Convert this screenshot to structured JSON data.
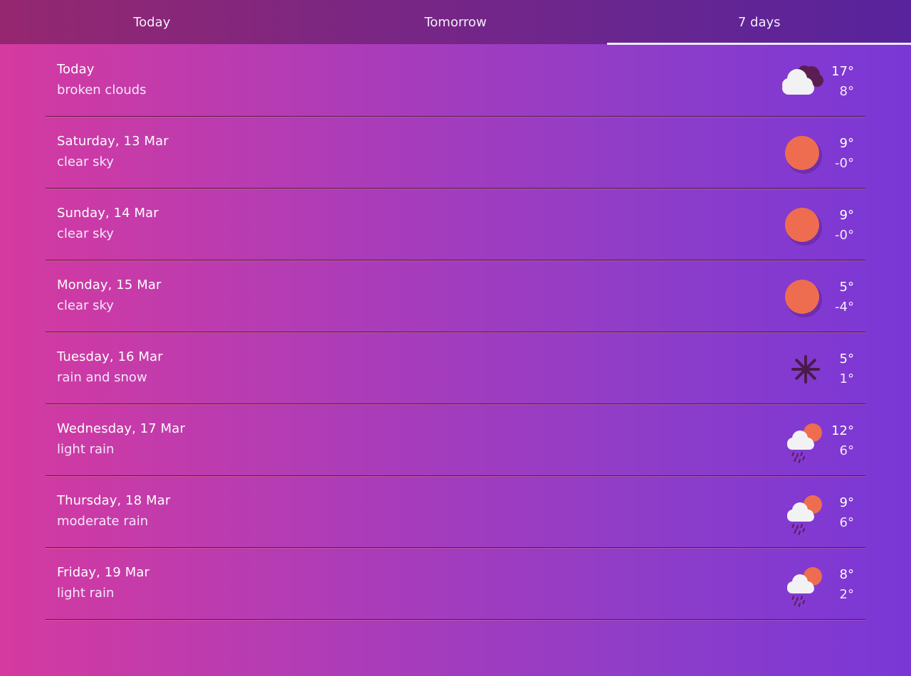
{
  "tabs": [
    {
      "label": "Today",
      "active": false
    },
    {
      "label": "Tomorrow",
      "active": false
    },
    {
      "label": "7 days",
      "active": true
    }
  ],
  "days": [
    {
      "name": "Today",
      "desc": "broken clouds",
      "hi": "17°",
      "lo": "8°",
      "icon": "broken-clouds-icon"
    },
    {
      "name": "Saturday, 13 Mar",
      "desc": "clear sky",
      "hi": "9°",
      "lo": "-0°",
      "icon": "sun-icon"
    },
    {
      "name": "Sunday, 14 Mar",
      "desc": "clear sky",
      "hi": "9°",
      "lo": "-0°",
      "icon": "sun-icon"
    },
    {
      "name": "Monday, 15 Mar",
      "desc": "clear sky",
      "hi": "5°",
      "lo": "-4°",
      "icon": "sun-icon"
    },
    {
      "name": "Tuesday, 16 Mar",
      "desc": "rain and snow",
      "hi": "5°",
      "lo": "1°",
      "icon": "snowflake-icon"
    },
    {
      "name": "Wednesday, 17 Mar",
      "desc": "light rain",
      "hi": "12°",
      "lo": "6°",
      "icon": "rain-sun-cloud-icon"
    },
    {
      "name": "Thursday, 18 Mar",
      "desc": "moderate rain",
      "hi": "9°",
      "lo": "6°",
      "icon": "rain-sun-cloud-icon"
    },
    {
      "name": "Friday, 19 Mar",
      "desc": "light rain",
      "hi": "8°",
      "lo": "2°",
      "icon": "rain-sun-cloud-icon"
    }
  ],
  "colors": {
    "sun": "#ee6d50",
    "cloud": "#f2f2f4",
    "dark_cloud": "#5a1e52",
    "snow": "#4b1a4a",
    "rain": "#5a1e52"
  }
}
